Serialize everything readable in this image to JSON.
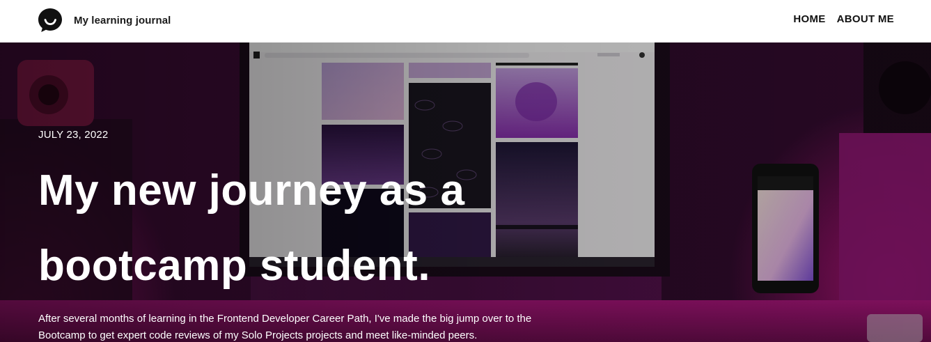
{
  "header": {
    "brand_name": "My learning journal",
    "logo_icon": "speech-bubble-smile-icon",
    "nav": [
      {
        "label": "HOME"
      },
      {
        "label": "ABOUT ME"
      }
    ]
  },
  "hero": {
    "date": "JULY 23, 2022",
    "title_line_1": "My new journey as a",
    "title_line_2": "bootcamp student.",
    "excerpt": "After several months of learning in the Frontend Developer Career Path, I've made the big jump over to the Bootcamp to get expert code reviews of my Solo Projects projects and meet like-minded peers."
  },
  "colors": {
    "header_bg": "#ffffff",
    "text_dark": "#111111",
    "hero_text": "#ffffff",
    "hero_accent": "#c2188f"
  }
}
